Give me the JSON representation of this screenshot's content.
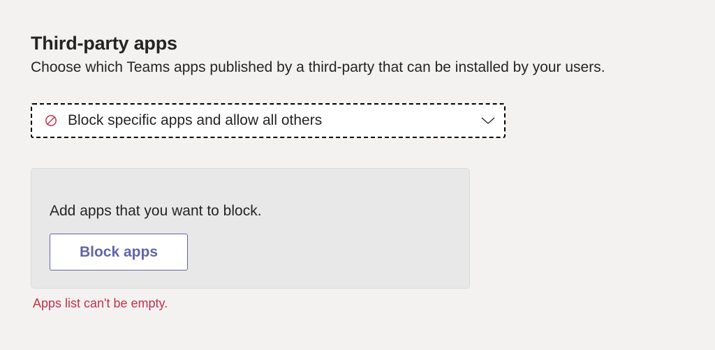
{
  "section": {
    "title": "Third-party apps",
    "subtitle": "Choose which Teams apps published by a third-party that can be installed by your users."
  },
  "dropdown": {
    "icon": "block-icon",
    "selected": "Block specific apps and allow all others",
    "chevron": "chevron-down-icon"
  },
  "panel": {
    "text": "Add apps that you want to block.",
    "button_label": "Block apps"
  },
  "error": {
    "text": "Apps list can't be empty."
  },
  "colors": {
    "background": "#f3f2f1",
    "accent": "#6264a7",
    "error": "#c4314b"
  }
}
